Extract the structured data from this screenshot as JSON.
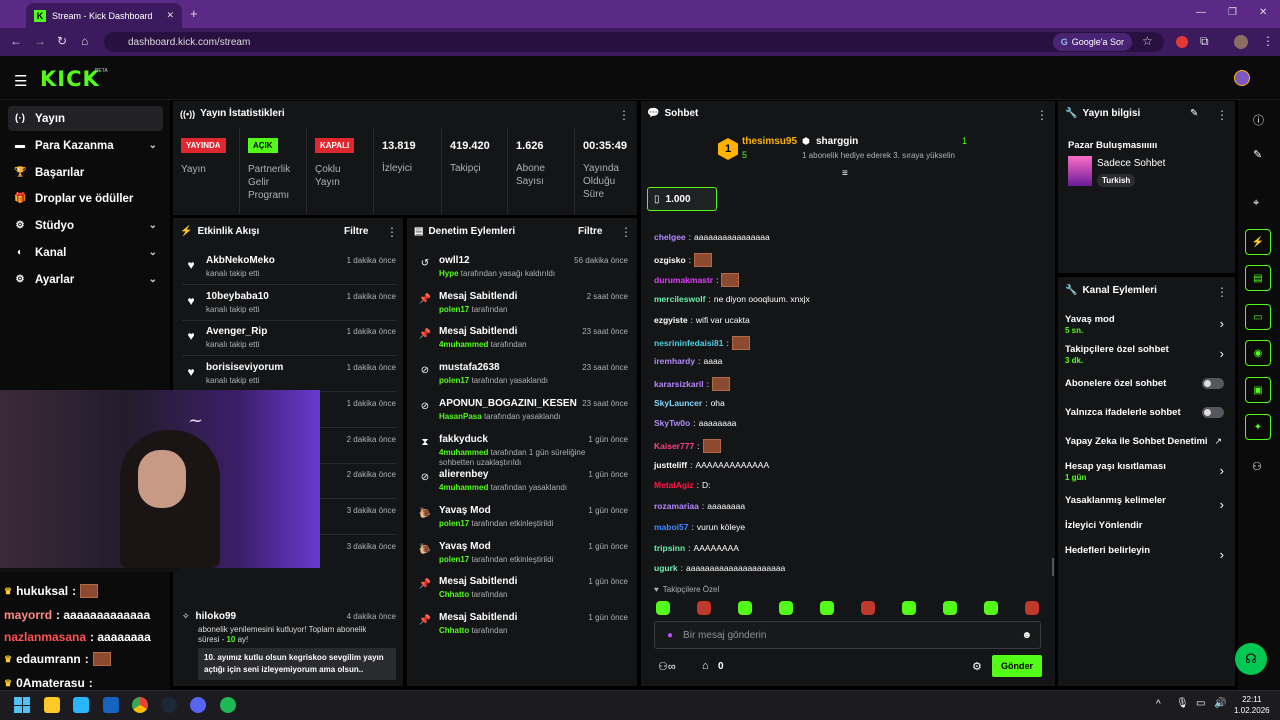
{
  "browser": {
    "tab_title": "Stream - Kick Dashboard",
    "url": "dashboard.kick.com/stream",
    "google_button": "Google'a Sor"
  },
  "header": {
    "logo": "KICK",
    "beta": "BETA"
  },
  "sidebar": {
    "items": [
      {
        "label": "Yayın",
        "icon": "broadcast-icon"
      },
      {
        "label": "Para Kazanma",
        "icon": "money-icon"
      },
      {
        "label": "Başarılar",
        "icon": "trophy-icon"
      },
      {
        "label": "Droplar ve ödüller",
        "icon": "gift-icon"
      },
      {
        "label": "Stüdyo",
        "icon": "studio-icon"
      },
      {
        "label": "Kanal",
        "icon": "channel-icon"
      },
      {
        "label": "Ayarlar",
        "icon": "gear-icon"
      }
    ]
  },
  "stats": {
    "title": "Yayın İstatistikleri",
    "items": [
      {
        "badge": "YAYINDA",
        "label": "Yayın",
        "color": "#e0262f"
      },
      {
        "badge": "AÇIK",
        "label": "Partnerlik Gelir Programı",
        "color": "#53fc18"
      },
      {
        "badge": "KAPALI",
        "label": "Çoklu Yayın",
        "color": "#e0262f"
      },
      {
        "value": "13.819",
        "label": "İzleyici"
      },
      {
        "value": "419.420",
        "label": "Takipçi"
      },
      {
        "value": "1.626",
        "label": "Abone Sayısı"
      },
      {
        "value": "00:35:49",
        "label": "Yayında Olduğu Süre"
      }
    ]
  },
  "activity": {
    "title": "Etkinlik Akışı",
    "filter": "Filtre",
    "items": [
      {
        "name": "AkbNekoMeko",
        "sub": "kanalı takip etti",
        "time": "1 dakika önce"
      },
      {
        "name": "10beybaba10",
        "sub": "kanalı takip etti",
        "time": "1 dakika önce"
      },
      {
        "name": "Avenger_Rip",
        "sub": "kanalı takip etti",
        "time": "1 dakika önce"
      },
      {
        "name": "borisiseviyorum",
        "sub": "kanalı takip etti",
        "time": "1 dakika önce"
      },
      {
        "name": "",
        "sub": "Toplam abonelik",
        "time": "1 dakika önce"
      },
      {
        "name": "",
        "sub": "",
        "time": "2 dakika önce"
      },
      {
        "name": "",
        "sub": "",
        "time": "2 dakika önce"
      },
      {
        "name": "",
        "sub": "",
        "time": "3 dakika önce"
      },
      {
        "name": "iso38a",
        "sub": "kanalı takip etti",
        "time": "3 dakika önce"
      }
    ],
    "last": {
      "name": "hiloko99",
      "time": "4 dakika önce",
      "line1": "abonelik yenilemesini kutluyor! Toplam abonelik",
      "line2": "süresi -",
      "months": "10",
      "line2b": "ay!",
      "msg1": "10. ayımız kutlu olsun kegriskoo sevgilim yayın",
      "msg2": "açtığı için seni izleyemiyorum ama olsun.."
    }
  },
  "moderation": {
    "title": "Denetim Eylemleri",
    "filter": "Filtre",
    "items": [
      {
        "icon": "undo-icon",
        "name": "owll12",
        "actor": "Hype",
        "sub": "tarafından yasağı kaldırıldı",
        "time": "56 dakika önce"
      },
      {
        "icon": "pin-icon",
        "name": "Mesaj Sabitlendi",
        "actor": "polen17",
        "sub": "tarafından",
        "time": "2 saat önce"
      },
      {
        "icon": "pin-icon",
        "name": "Mesaj Sabitlendi",
        "actor": "4muhammed",
        "sub": "tarafından",
        "time": "23 saat önce"
      },
      {
        "icon": "ban-icon",
        "name": "mustafa2638",
        "actor": "polen17",
        "sub": "tarafından yasaklandı",
        "time": "23 saat önce"
      },
      {
        "icon": "ban-icon",
        "name": "APONUN_BOGAZINI_KESEN",
        "actor": "HasanPasa",
        "sub": "tarafından yasaklandı",
        "time": "23 saat önce"
      },
      {
        "icon": "hourglass-icon",
        "name": "fakkyduck",
        "actor": "4muhammed",
        "sub": "tarafından 1 gün süreliğine",
        "sub2": "sohbetten uzaklaştırıldı",
        "time": "1 gün önce"
      },
      {
        "icon": "ban-icon",
        "name": "alierenbey",
        "actor": "4muhammed",
        "sub": "tarafından yasaklandı",
        "time": "1 gün önce"
      },
      {
        "icon": "snail-icon",
        "name": "Yavaş Mod",
        "actor": "polen17",
        "sub": "tarafından etkinleştirildi",
        "time": "1 gün önce"
      },
      {
        "icon": "snail-icon",
        "name": "Yavaş Mod",
        "actor": "polen17",
        "sub": "tarafından etkinleştirildi",
        "time": "1 gün önce"
      },
      {
        "icon": "pin-icon",
        "name": "Mesaj Sabitlendi",
        "actor": "Chhatto",
        "sub": "tarafından",
        "time": "1 gün önce"
      },
      {
        "icon": "pin-icon",
        "name": "Mesaj Sabitlendi",
        "actor": "Chhatto",
        "sub": "tarafından",
        "time": "1 gün önce"
      }
    ]
  },
  "chat": {
    "title": "Sohbet",
    "gift_rank": "1",
    "gifter": "thesimsu95",
    "gifter_count": "5",
    "recipient": "sharggin",
    "recipient_count": "1",
    "gift_text": "1 abonelik hediye ederek 3. sıraya yükselin",
    "pinned_count": "1.000",
    "messages": [
      {
        "user": "chelgee",
        "text": "aaaaaaaaaaaaaaaa",
        "color": "#b388ff"
      },
      {
        "user": "ozgisko",
        "text": "",
        "color": "#ffffff"
      },
      {
        "user": "durumakmastr",
        "text": "",
        "color": "#e040fb"
      },
      {
        "user": "mercileswolf",
        "text": "ne diyon oooqluum. xnxjx",
        "color": "#69f0ae"
      },
      {
        "user": "ezgyiste",
        "text": "wifi var ucakta",
        "color": "#ffffff"
      },
      {
        "user": "nesrininfedaisi81",
        "text": "",
        "color": "#4dd0e1"
      },
      {
        "user": "iremhardy",
        "text": "aaaa",
        "color": "#b388ff"
      },
      {
        "user": "kararsizkaril",
        "text": "",
        "color": "#b388ff"
      },
      {
        "user": "SkyLauncer",
        "text": "oha",
        "color": "#80d8ff"
      },
      {
        "user": "SkyTw0o",
        "text": "aaaaaaaa",
        "color": "#b388ff"
      },
      {
        "user": "Kaiser777",
        "text": "",
        "color": "#ff4081"
      },
      {
        "user": "justteliff",
        "text": "AAAAAAAAAAAAA",
        "color": "#ffffff"
      },
      {
        "user": "MetalAgiz",
        "text": "D:",
        "color": "#ff1744"
      },
      {
        "user": "rozamariaa",
        "text": "aaaaaaaa",
        "color": "#b388ff"
      },
      {
        "user": "maboi57",
        "text": "vurun köleye",
        "color": "#448aff"
      },
      {
        "user": "tripsinn",
        "text": "AAAAAAAA",
        "color": "#69f0ae"
      },
      {
        "user": "ugurk",
        "text": "aaaaaaaaaaaaaaaaaaaaa",
        "color": "#69f0ae"
      }
    ],
    "followers_only": "Takipçilere Özel",
    "input_placeholder": "Bir mesaj gönderin",
    "send": "Gönder",
    "points": "0"
  },
  "stream_info": {
    "title": "Yayın bilgisi",
    "stream_title": "Pazar Buluşmasıııııı",
    "category": "Sadece Sohbet",
    "tag": "Turkish"
  },
  "channel_actions": {
    "title": "Kanal Eylemleri",
    "items": [
      {
        "label": "Yavaş mod",
        "sub": "5 sn.",
        "control": "chevron"
      },
      {
        "label": "Takipçilere özel sohbet",
        "sub": "3 dk.",
        "control": "chevron"
      },
      {
        "label": "Abonelere özel sohbet",
        "sub": "",
        "control": "toggle"
      },
      {
        "label": "Yalnızca ifadelerle sohbet",
        "sub": "",
        "control": "toggle"
      },
      {
        "label": "Yapay Zeka ile Sohbet Denetimi",
        "sub": "",
        "control": "external"
      },
      {
        "label": "Hesap yaşı kısıtlaması",
        "sub": "1 gün",
        "control": "chevron"
      },
      {
        "label": "Yasaklanmış kelimeler",
        "sub": "",
        "control": "chevron"
      },
      {
        "label": "İzleyici Yönlendir",
        "sub": "",
        "control": "none"
      },
      {
        "label": "Hedefleri belirleyin",
        "sub": "",
        "control": "chevron"
      }
    ]
  },
  "overlay_chat": [
    {
      "user": "hukuksal",
      "text": ":",
      "color": "#ffffff"
    },
    {
      "user": "mayorrd",
      "text": ": aaaaaaaaaaaaa",
      "color": "#ff8a80"
    },
    {
      "user": "nazlanmasana",
      "text": ": aaaaaaaa",
      "color": "#ff5252"
    },
    {
      "user": "edaumrann",
      "text": ":",
      "color": "#ffffff"
    },
    {
      "user": "0Amaterasu",
      "text": ":",
      "color": "#ffffff"
    }
  ],
  "taskbar": {
    "time": "22:11",
    "date": "1.02.2026"
  }
}
